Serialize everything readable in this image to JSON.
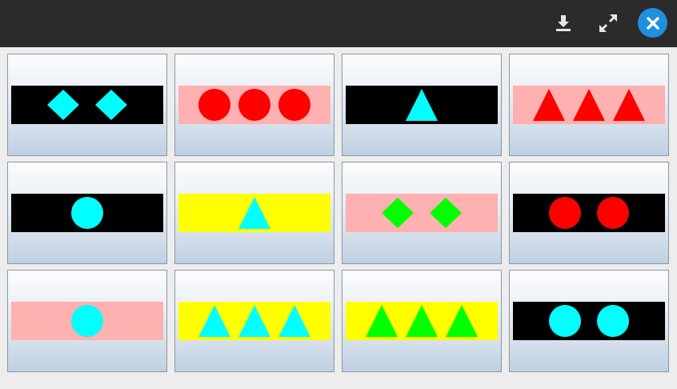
{
  "toolbar": {
    "download_icon": "download-icon",
    "expand_icon": "expand-icon",
    "close_icon": "close-icon",
    "close_color": "#1f8fe0"
  },
  "cards": [
    {
      "band": "#000000",
      "shape": "diamond",
      "color": "#00ffff",
      "count": 2
    },
    {
      "band": "#ffb0b0",
      "shape": "circle",
      "color": "#ff0000",
      "count": 3
    },
    {
      "band": "#000000",
      "shape": "triangle",
      "color": "#00ffff",
      "count": 1
    },
    {
      "band": "#ffb0b0",
      "shape": "triangle",
      "color": "#ff0000",
      "count": 3
    },
    {
      "band": "#000000",
      "shape": "circle",
      "color": "#00ffff",
      "count": 1
    },
    {
      "band": "#ffff00",
      "shape": "triangle",
      "color": "#00ffff",
      "count": 1
    },
    {
      "band": "#ffb0b0",
      "shape": "diamond",
      "color": "#00ff00",
      "count": 2
    },
    {
      "band": "#000000",
      "shape": "circle",
      "color": "#ff0000",
      "count": 2
    },
    {
      "band": "#ffb0b0",
      "shape": "circle",
      "color": "#00ffff",
      "count": 1
    },
    {
      "band": "#ffff00",
      "shape": "triangle",
      "color": "#00ffff",
      "count": 3
    },
    {
      "band": "#ffff00",
      "shape": "triangle",
      "color": "#00ff00",
      "count": 3
    },
    {
      "band": "#000000",
      "shape": "circle",
      "color": "#00ffff",
      "count": 2
    }
  ]
}
